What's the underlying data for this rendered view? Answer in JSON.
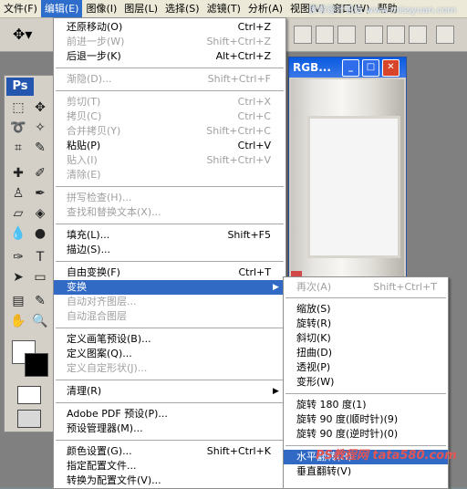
{
  "menubar": {
    "items": [
      {
        "label": "文件(F)"
      },
      {
        "label": "编辑(E)"
      },
      {
        "label": "图像(I)"
      },
      {
        "label": "图层(L)"
      },
      {
        "label": "选择(S)"
      },
      {
        "label": "滤镜(T)"
      },
      {
        "label": "分析(A)"
      },
      {
        "label": "视图(V)"
      },
      {
        "label": "窗口(W)"
      },
      {
        "label": "帮助"
      }
    ],
    "watermark": "思缘设计论坛 www.missyuan.com"
  },
  "toolbox": {
    "logo": "Ps"
  },
  "document": {
    "title": "RGB..."
  },
  "edit_menu": {
    "items": [
      {
        "label": "还原移动(O)",
        "shortcut": "Ctrl+Z",
        "enabled": true
      },
      {
        "label": "前进一步(W)",
        "shortcut": "Shift+Ctrl+Z",
        "enabled": false
      },
      {
        "label": "后退一步(K)",
        "shortcut": "Alt+Ctrl+Z",
        "enabled": true
      },
      {
        "label": "渐隐(D)...",
        "shortcut": "Shift+Ctrl+F",
        "enabled": false
      },
      {
        "label": "剪切(T)",
        "shortcut": "Ctrl+X",
        "enabled": false
      },
      {
        "label": "拷贝(C)",
        "shortcut": "Ctrl+C",
        "enabled": false
      },
      {
        "label": "合并拷贝(Y)",
        "shortcut": "Shift+Ctrl+C",
        "enabled": false
      },
      {
        "label": "粘贴(P)",
        "shortcut": "Ctrl+V",
        "enabled": true
      },
      {
        "label": "贴入(I)",
        "shortcut": "Shift+Ctrl+V",
        "enabled": false
      },
      {
        "label": "清除(E)",
        "shortcut": "",
        "enabled": false
      },
      {
        "label": "拼写检查(H)...",
        "shortcut": "",
        "enabled": false
      },
      {
        "label": "查找和替换文本(X)...",
        "shortcut": "",
        "enabled": false
      },
      {
        "label": "填充(L)...",
        "shortcut": "Shift+F5",
        "enabled": true
      },
      {
        "label": "描边(S)...",
        "shortcut": "",
        "enabled": true
      },
      {
        "label": "自由变换(F)",
        "shortcut": "Ctrl+T",
        "enabled": true
      },
      {
        "label": "变换",
        "shortcut": "",
        "enabled": true,
        "highlighted": true,
        "submenu": true
      },
      {
        "label": "自动对齐图层...",
        "shortcut": "",
        "enabled": false
      },
      {
        "label": "自动混合图层",
        "shortcut": "",
        "enabled": false
      },
      {
        "label": "定义画笔预设(B)...",
        "shortcut": "",
        "enabled": true
      },
      {
        "label": "定义图案(Q)...",
        "shortcut": "",
        "enabled": true
      },
      {
        "label": "定义自定形状(J)...",
        "shortcut": "",
        "enabled": false
      },
      {
        "label": "清理(R)",
        "shortcut": "",
        "enabled": true,
        "submenu": true
      },
      {
        "label": "Adobe PDF 预设(P)...",
        "shortcut": "",
        "enabled": true
      },
      {
        "label": "预设管理器(M)...",
        "shortcut": "",
        "enabled": true
      },
      {
        "label": "颜色设置(G)...",
        "shortcut": "Shift+Ctrl+K",
        "enabled": true
      },
      {
        "label": "指定配置文件...",
        "shortcut": "",
        "enabled": true
      },
      {
        "label": "转换为配置文件(V)...",
        "shortcut": "",
        "enabled": true
      }
    ]
  },
  "transform_submenu": {
    "items": [
      {
        "label": "再次(A)",
        "shortcut": "Shift+Ctrl+T",
        "enabled": false
      },
      {
        "label": "缩放(S)",
        "shortcut": "",
        "enabled": true
      },
      {
        "label": "旋转(R)",
        "shortcut": "",
        "enabled": true
      },
      {
        "label": "斜切(K)",
        "shortcut": "",
        "enabled": true
      },
      {
        "label": "扭曲(D)",
        "shortcut": "",
        "enabled": true
      },
      {
        "label": "透视(P)",
        "shortcut": "",
        "enabled": true
      },
      {
        "label": "变形(W)",
        "shortcut": "",
        "enabled": true
      },
      {
        "label": "旋转 180 度(1)",
        "shortcut": "",
        "enabled": true
      },
      {
        "label": "旋转 90 度(顺时针)(9)",
        "shortcut": "",
        "enabled": true
      },
      {
        "label": "旋转 90 度(逆时针)(0)",
        "shortcut": "",
        "enabled": true
      },
      {
        "label": "水平翻转(H)",
        "shortcut": "",
        "enabled": true,
        "highlighted": true
      },
      {
        "label": "垂直翻转(V)",
        "shortcut": "",
        "enabled": true
      }
    ]
  },
  "brand_watermark": "PS教程网 tata580.com"
}
